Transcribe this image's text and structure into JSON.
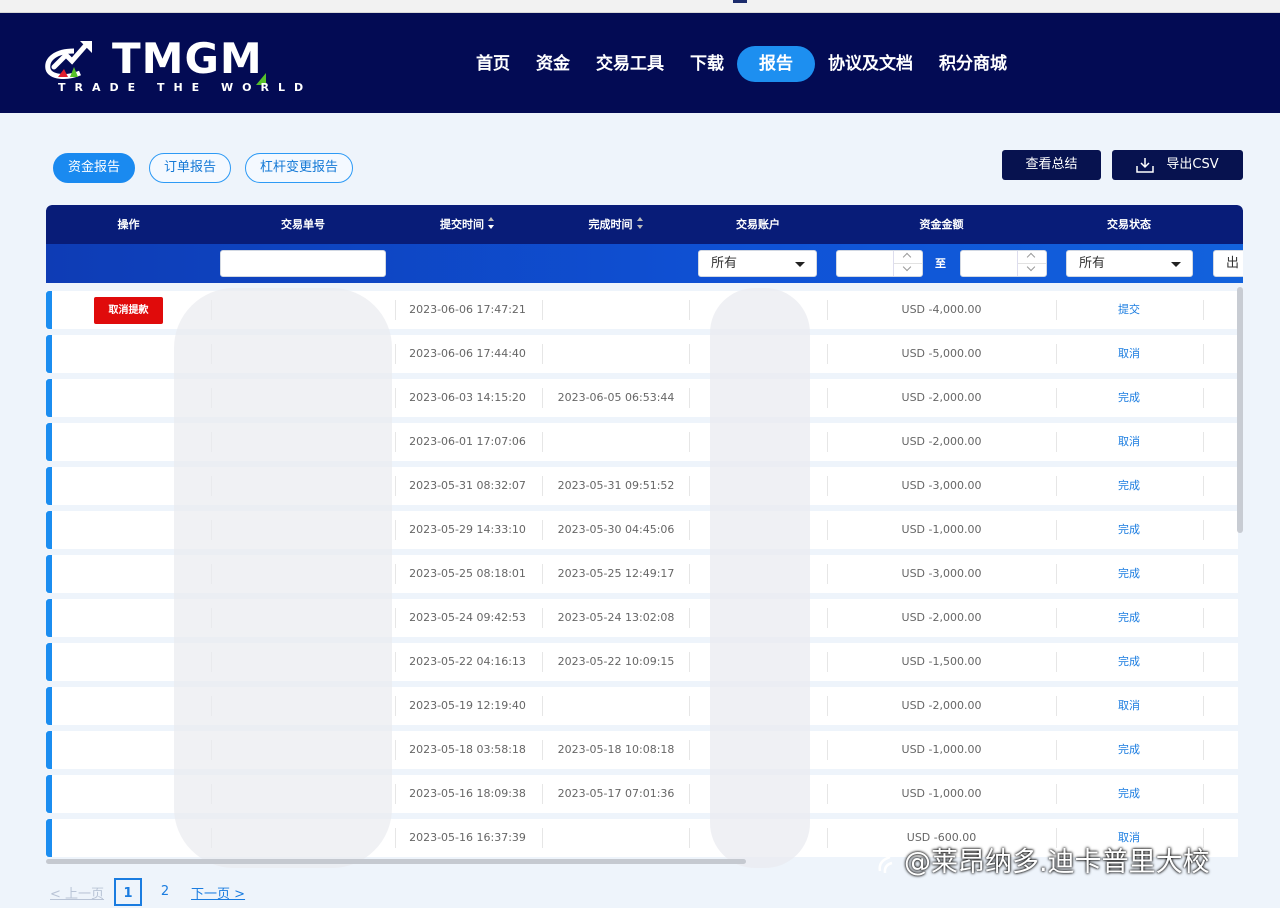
{
  "brand": {
    "name": "TMGM",
    "tagline": "TRADE THE WORLD"
  },
  "nav": [
    {
      "label": "首页"
    },
    {
      "label": "资金"
    },
    {
      "label": "交易工具"
    },
    {
      "label": "下载"
    },
    {
      "label": "报告",
      "active": true
    },
    {
      "label": "协议及文档"
    },
    {
      "label": "积分商城"
    }
  ],
  "subtabs": [
    {
      "label": "资金报告",
      "active": true
    },
    {
      "label": "订单报告"
    },
    {
      "label": "杠杆变更报告"
    }
  ],
  "actions": {
    "summary": "查看总结",
    "export": "导出CSV"
  },
  "table": {
    "headers": {
      "action": "操作",
      "order_no": "交易单号",
      "submit_time": "提交时间",
      "complete_time": "完成时间",
      "account": "交易账户",
      "amount": "资金金额",
      "status": "交易状态"
    },
    "filters": {
      "account_select": "所有",
      "amount_range_sep": "至",
      "status_select": "所有",
      "type_select_partial": "出"
    },
    "cancel_label": "取消提款",
    "rows": [
      {
        "submit": "2023-06-06 17:47:21",
        "complete": "",
        "amount": "USD -4,000.00",
        "status": "提交",
        "cancel": true
      },
      {
        "submit": "2023-06-06 17:44:40",
        "complete": "",
        "amount": "USD -5,000.00",
        "status": "取消"
      },
      {
        "submit": "2023-06-03 14:15:20",
        "complete": "2023-06-05 06:53:44",
        "amount": "USD -2,000.00",
        "status": "完成"
      },
      {
        "submit": "2023-06-01 17:07:06",
        "complete": "",
        "amount": "USD -2,000.00",
        "status": "取消"
      },
      {
        "submit": "2023-05-31 08:32:07",
        "complete": "2023-05-31 09:51:52",
        "amount": "USD -3,000.00",
        "status": "完成"
      },
      {
        "submit": "2023-05-29 14:33:10",
        "complete": "2023-05-30 04:45:06",
        "amount": "USD -1,000.00",
        "status": "完成"
      },
      {
        "submit": "2023-05-25 08:18:01",
        "complete": "2023-05-25 12:49:17",
        "amount": "USD -3,000.00",
        "status": "完成"
      },
      {
        "submit": "2023-05-24 09:42:53",
        "complete": "2023-05-24 13:02:08",
        "amount": "USD -2,000.00",
        "status": "完成"
      },
      {
        "submit": "2023-05-22 04:16:13",
        "complete": "2023-05-22 10:09:15",
        "amount": "USD -1,500.00",
        "status": "完成"
      },
      {
        "submit": "2023-05-19 12:19:40",
        "complete": "",
        "amount": "USD -2,000.00",
        "status": "取消"
      },
      {
        "submit": "2023-05-18 03:58:18",
        "complete": "2023-05-18 10:08:18",
        "amount": "USD -1,000.00",
        "status": "完成"
      },
      {
        "submit": "2023-05-16 18:09:38",
        "complete": "2023-05-17 07:01:36",
        "amount": "USD -1,000.00",
        "status": "完成"
      },
      {
        "submit": "2023-05-16 16:37:39",
        "complete": "",
        "amount": "USD -600.00",
        "status": "取消"
      }
    ]
  },
  "pagination": {
    "prev": "< 上一页",
    "pages": [
      "1",
      "2"
    ],
    "current": "1",
    "next": "下一页 >"
  },
  "watermark": "@莱昂纳多.迪卡普里大校",
  "colors": {
    "navbar": "#030b54",
    "accent": "#1a8af0",
    "cancel_button": "#e00b0b",
    "table_header": "#081c78"
  }
}
